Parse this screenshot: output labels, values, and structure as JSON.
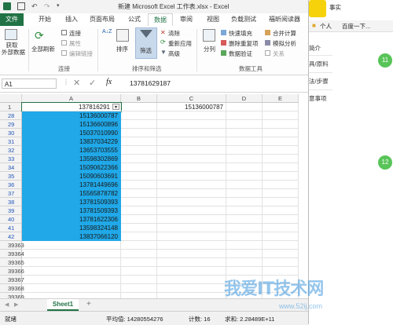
{
  "window": {
    "title": "新建 Microsoft Excel 工作表.xlsx - Excel"
  },
  "tabs": [
    "文件",
    "开始",
    "插入",
    "页面布局",
    "公式",
    "数据",
    "审阅",
    "视图",
    "负载测试",
    "福昕阅读器"
  ],
  "ribbon": {
    "get_external": "获取\n外部数据",
    "refresh_all": "全部刷新",
    "connections": "连接",
    "properties": "属性",
    "edit_links": "编辑链接",
    "group_connections": "连接",
    "sort_az": "A↓Z",
    "sort": "排序",
    "filter": "筛选",
    "clear": "清除",
    "reapply": "重新应用",
    "advanced": "高级",
    "group_sort_filter": "排序和筛选",
    "text_to_columns": "分列",
    "flash_fill": "快速填充",
    "remove_duplicates": "删除重复项",
    "data_validation": "数据验证",
    "consolidate": "合并计算",
    "what_if": "模拟分析",
    "relationships": "关系",
    "group_data_tools": "数据工具"
  },
  "formula_bar": {
    "name_box": "A1",
    "fx": "fx",
    "value": "13781629187"
  },
  "columns": [
    "A",
    "B",
    "C",
    "D",
    "E"
  ],
  "row1": {
    "row": "1",
    "a": "137816291",
    "c": "15136000787"
  },
  "filtered_rows": [
    {
      "row": "28",
      "value": "15136000787"
    },
    {
      "row": "29",
      "value": "15136600896"
    },
    {
      "row": "30",
      "value": "15037010990"
    },
    {
      "row": "31",
      "value": "13837034229"
    },
    {
      "row": "32",
      "value": "13653703555"
    },
    {
      "row": "33",
      "value": "13598302869"
    },
    {
      "row": "34",
      "value": "15090622366"
    },
    {
      "row": "35",
      "value": "15090603691"
    },
    {
      "row": "36",
      "value": "13781449696"
    },
    {
      "row": "37",
      "value": "15565878782"
    },
    {
      "row": "38",
      "value": "13781509393"
    },
    {
      "row": "39",
      "value": "13781509393"
    },
    {
      "row": "40",
      "value": "13781622306"
    },
    {
      "row": "41",
      "value": "13598324148"
    },
    {
      "row": "42",
      "value": "13837066120"
    }
  ],
  "empty_rows": [
    "39363",
    "39364",
    "39365",
    "39366",
    "39367",
    "39368",
    "39369"
  ],
  "sheet": {
    "name": "Sheet1",
    "add": "+"
  },
  "status": {
    "ready": "就绪",
    "average": "平均值: 14280554276",
    "count": "计数: 16",
    "sum": "求和: 2.28489E+11"
  },
  "side_panel": {
    "tab1": "事实",
    "address": "个人",
    "baidu": "百度一下...",
    "item1": "简介",
    "item2": "具/原料",
    "item3": "法/步骤",
    "item4": "意事项",
    "badge1": "11",
    "badge2": "12"
  },
  "watermark": {
    "main": "我爱IT技术网",
    "sub": "www.52ij.com"
  },
  "colors": {
    "excel_green": "#217346",
    "selection": "#20a8e8",
    "badge": "#58c458"
  }
}
